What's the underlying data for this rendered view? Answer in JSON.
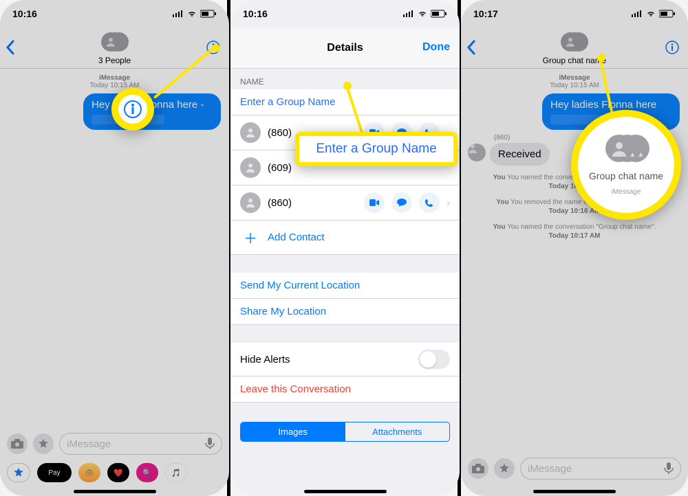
{
  "s1": {
    "time": "10:16",
    "title": "3 People",
    "meta_label": "iMessage",
    "meta_time": "Today 10:15 AM",
    "bubble": "Hey ladies Fionna here -",
    "compose_placeholder": "iMessage",
    "drawer": {
      "apple_pay": "Pay"
    }
  },
  "s2": {
    "time": "10:16",
    "title": "Details",
    "done": "Done",
    "section_name": "NAME",
    "group_placeholder": "Enter a Group Name",
    "contacts": [
      "(860)",
      "(609)",
      "(860)"
    ],
    "add_contact": "Add Contact",
    "send_loc": "Send My Current Location",
    "share_loc": "Share My Location",
    "hide_alerts": "Hide Alerts",
    "leave": "Leave this Conversation",
    "seg_on": "Images",
    "seg_off": "Attachments",
    "zoom_text": "Enter a Group Name"
  },
  "s3": {
    "time": "10:17",
    "title": "Group chat name",
    "meta_label": "iMessage",
    "meta_time": "Today 10:15 AM",
    "bubble": "Hey ladies Fionna here",
    "incoming_sender": "(860)",
    "incoming_text": "Received",
    "sys1": "You named the conversation \"Group chat name\".",
    "sys1_time": "Today 10:16 AM",
    "sys2": "You removed the name from this conversation.",
    "sys2_time": "Today 10:16 AM",
    "sys3": "You named the conversation \"Group chat name\".",
    "sys3_time": "Today 10:17 AM",
    "compose_placeholder": "iMessage",
    "zoom_label": "Group chat name",
    "zoom_sub": "iMessage"
  }
}
